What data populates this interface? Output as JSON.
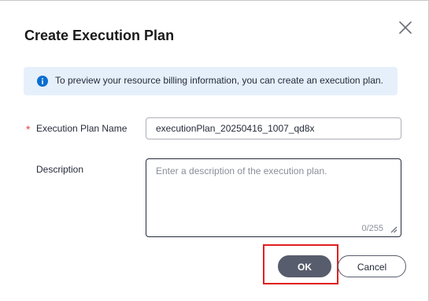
{
  "dialog": {
    "title": "Create Execution Plan",
    "close_icon": "close-icon"
  },
  "banner": {
    "icon": "info-icon",
    "text": "To preview your resource billing information, you can create an execution plan.",
    "color": "#e6f0fb",
    "icon_color": "#0a6ed1"
  },
  "form": {
    "name": {
      "required_mark": "*",
      "label": "Execution Plan Name",
      "value": "executionPlan_20250416_1007_qd8x"
    },
    "description": {
      "label": "Description",
      "placeholder": "Enter a description of the execution plan.",
      "counter": "0/255"
    }
  },
  "actions": {
    "ok_label": "OK",
    "cancel_label": "Cancel",
    "ok_color": "#575d6c",
    "highlight_color": "#e02020"
  }
}
